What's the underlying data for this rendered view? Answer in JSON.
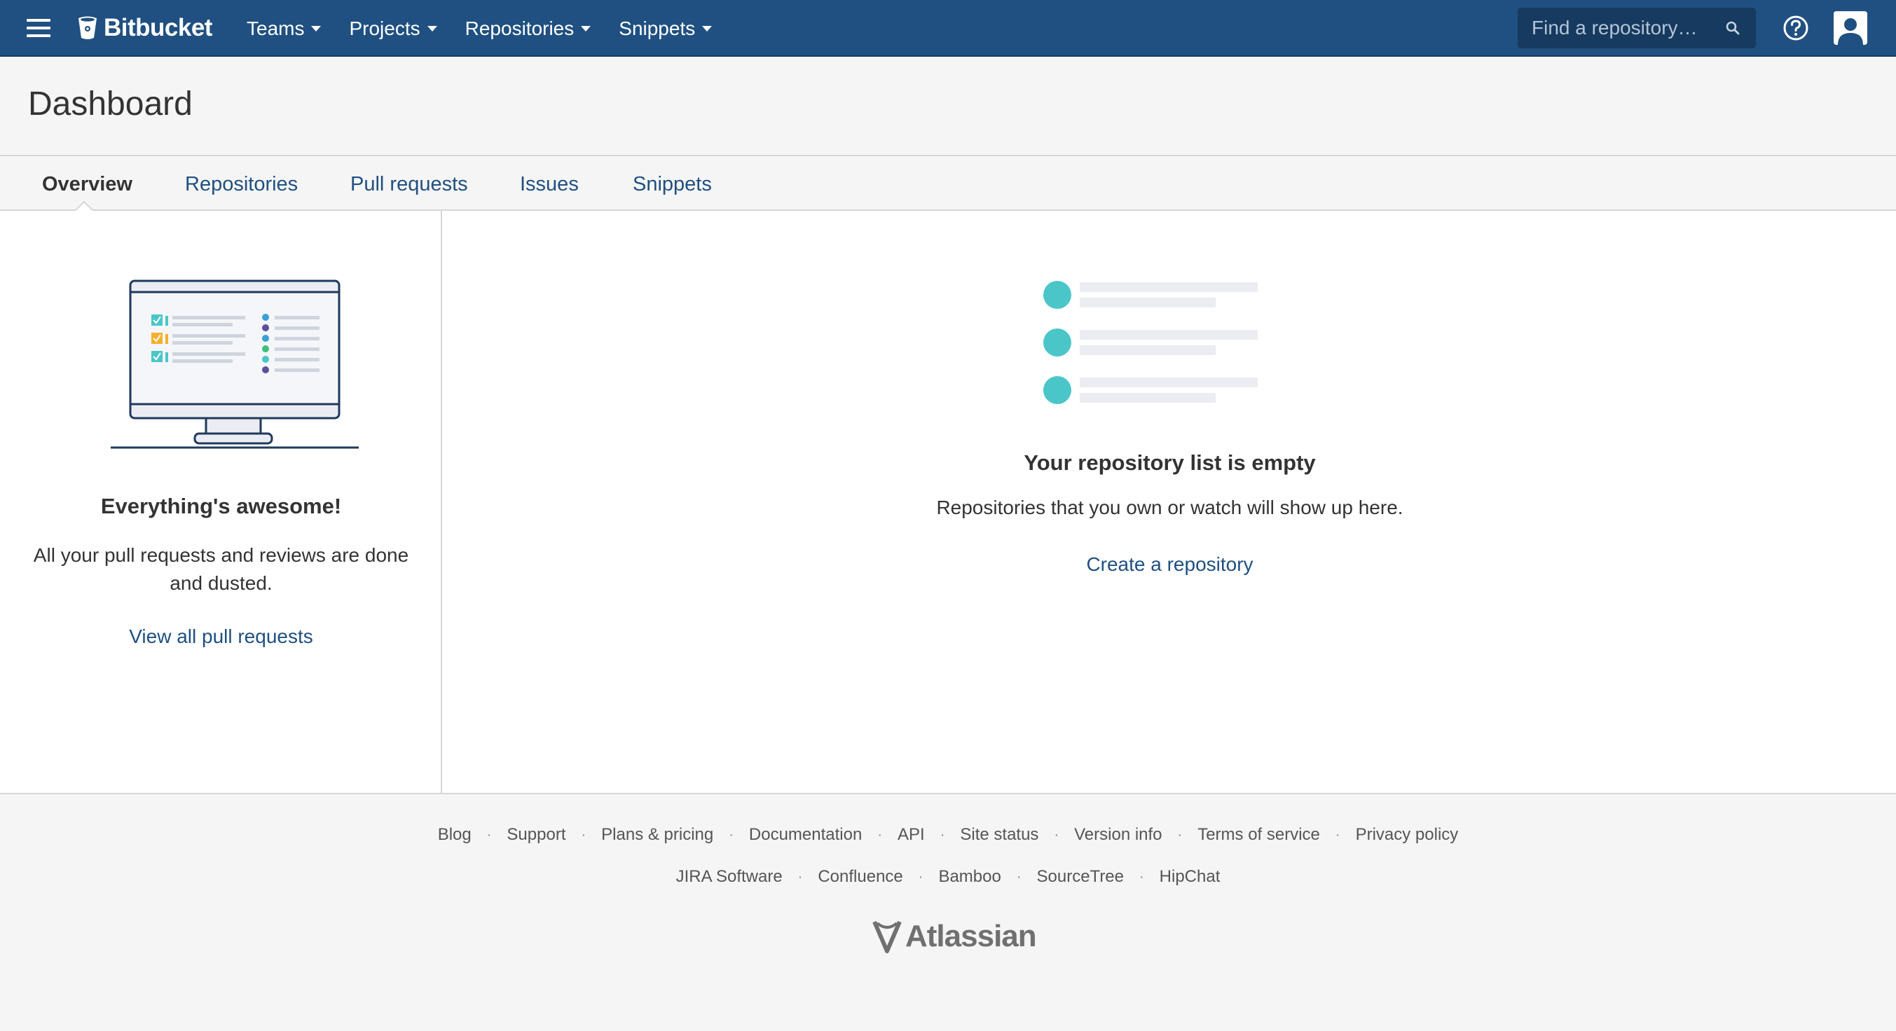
{
  "header": {
    "brand": "Bitbucket",
    "nav": [
      {
        "label": "Teams"
      },
      {
        "label": "Projects"
      },
      {
        "label": "Repositories"
      },
      {
        "label": "Snippets"
      }
    ],
    "search_placeholder": "Find a repository…",
    "icons": [
      "menu-icon",
      "bitbucket-logo-icon",
      "search-icon",
      "help-icon",
      "user-avatar-icon"
    ]
  },
  "page": {
    "title": "Dashboard"
  },
  "tabs": [
    {
      "label": "Overview",
      "active": true
    },
    {
      "label": "Repositories",
      "active": false
    },
    {
      "label": "Pull requests",
      "active": false
    },
    {
      "label": "Issues",
      "active": false
    },
    {
      "label": "Snippets",
      "active": false
    }
  ],
  "pull_requests_panel": {
    "heading": "Everything's awesome!",
    "message": "All your pull requests and reviews are done and dusted.",
    "link": "View all pull requests"
  },
  "repositories_panel": {
    "heading": "Your repository list is empty",
    "message": "Repositories that you own or watch will show up here.",
    "link": "Create a repository"
  },
  "footer": {
    "links_row1": [
      "Blog",
      "Support",
      "Plans & pricing",
      "Documentation",
      "API",
      "Site status",
      "Version info",
      "Terms of service",
      "Privacy policy"
    ],
    "links_row2": [
      "JIRA Software",
      "Confluence",
      "Bamboo",
      "SourceTree",
      "HipChat"
    ],
    "logo": "Atlassian"
  },
  "colors": {
    "header_bg": "#205081",
    "link": "#205081",
    "accent_teal": "#4bc6c8",
    "page_bg": "#f5f5f5"
  }
}
